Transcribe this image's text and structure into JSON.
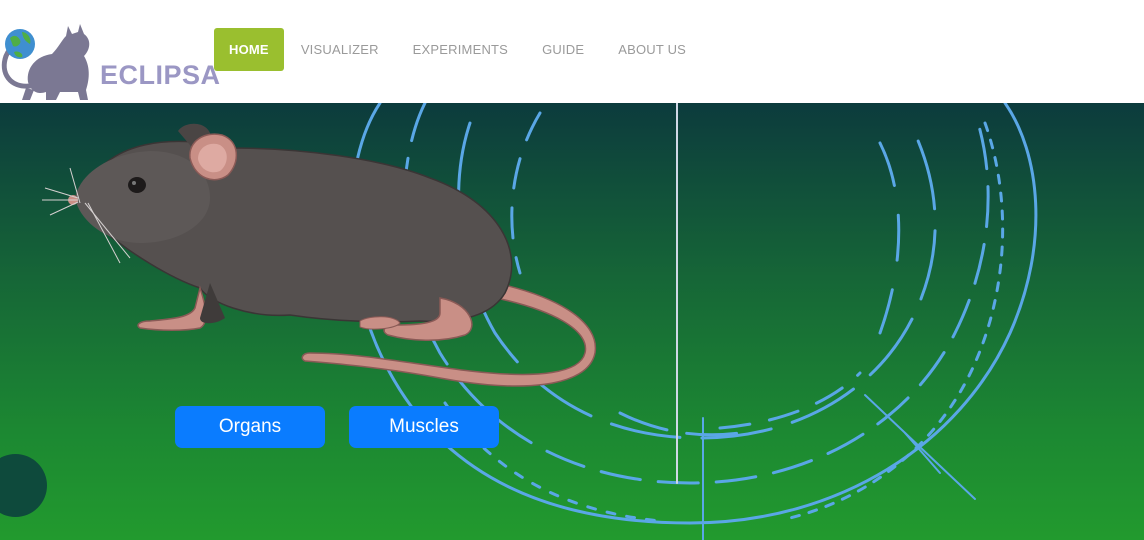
{
  "brand": {
    "name": "ECLIPSA",
    "logo_icon": "cat-globe-logo"
  },
  "nav": {
    "items": [
      {
        "label": "HOME",
        "active": true
      },
      {
        "label": "VISUALIZER",
        "active": false
      },
      {
        "label": "EXPERIMENTS",
        "active": false
      },
      {
        "label": "GUIDE",
        "active": false
      },
      {
        "label": "ABOUT US",
        "active": false
      }
    ]
  },
  "hero": {
    "illustration": "mouse-illustration",
    "buttons": {
      "organs": "Organs",
      "muscles": "Muscles"
    }
  },
  "colors": {
    "nav_active": "#9abf2f",
    "button": "#0a7cff",
    "brand_text": "#9b97c4",
    "hero_top": "#0c3b3d",
    "hero_bottom": "#229a2e",
    "rings": "#5aa7e6"
  }
}
